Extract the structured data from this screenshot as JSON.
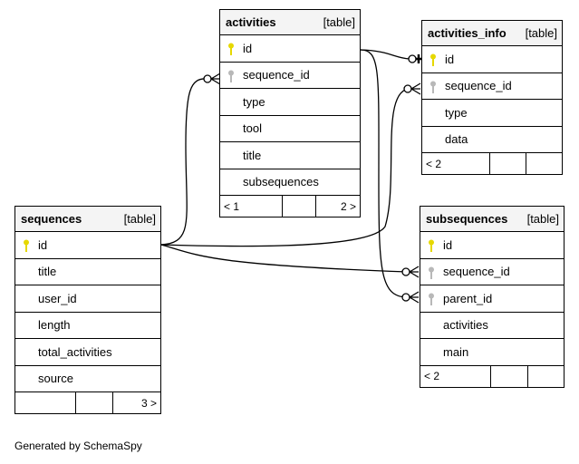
{
  "tables": {
    "activities": {
      "name": "activities",
      "kind": "[table]",
      "columns": [
        {
          "name": "id",
          "key": "primary"
        },
        {
          "name": "sequence_id",
          "key": "foreign"
        },
        {
          "name": "type",
          "key": ""
        },
        {
          "name": "tool",
          "key": ""
        },
        {
          "name": "title",
          "key": ""
        },
        {
          "name": "subsequences",
          "key": ""
        }
      ],
      "footer": [
        "< 1",
        "",
        "2 >"
      ]
    },
    "activities_info": {
      "name": "activities_info",
      "kind": "[table]",
      "columns": [
        {
          "name": "id",
          "key": "primary"
        },
        {
          "name": "sequence_id",
          "key": "foreign"
        },
        {
          "name": "type",
          "key": ""
        },
        {
          "name": "data",
          "key": ""
        }
      ],
      "footer": [
        "< 2",
        "",
        ""
      ]
    },
    "sequences": {
      "name": "sequences",
      "kind": "[table]",
      "columns": [
        {
          "name": "id",
          "key": "primary"
        },
        {
          "name": "title",
          "key": ""
        },
        {
          "name": "user_id",
          "key": ""
        },
        {
          "name": "length",
          "key": ""
        },
        {
          "name": "total_activities",
          "key": ""
        },
        {
          "name": "source",
          "key": ""
        }
      ],
      "footer": [
        "",
        "",
        "3 >"
      ]
    },
    "subsequences": {
      "name": "subsequences",
      "kind": "[table]",
      "columns": [
        {
          "name": "id",
          "key": "primary"
        },
        {
          "name": "sequence_id",
          "key": "foreign"
        },
        {
          "name": "parent_id",
          "key": "foreign"
        },
        {
          "name": "activities",
          "key": ""
        },
        {
          "name": "main",
          "key": ""
        }
      ],
      "footer": [
        "< 2",
        "",
        ""
      ]
    }
  },
  "colors": {
    "primary_key": "#e6d800",
    "foreign_key": "#b8b8b8",
    "header_bg": "#f4f4f4"
  },
  "footer_text": "Generated by SchemaSpy"
}
